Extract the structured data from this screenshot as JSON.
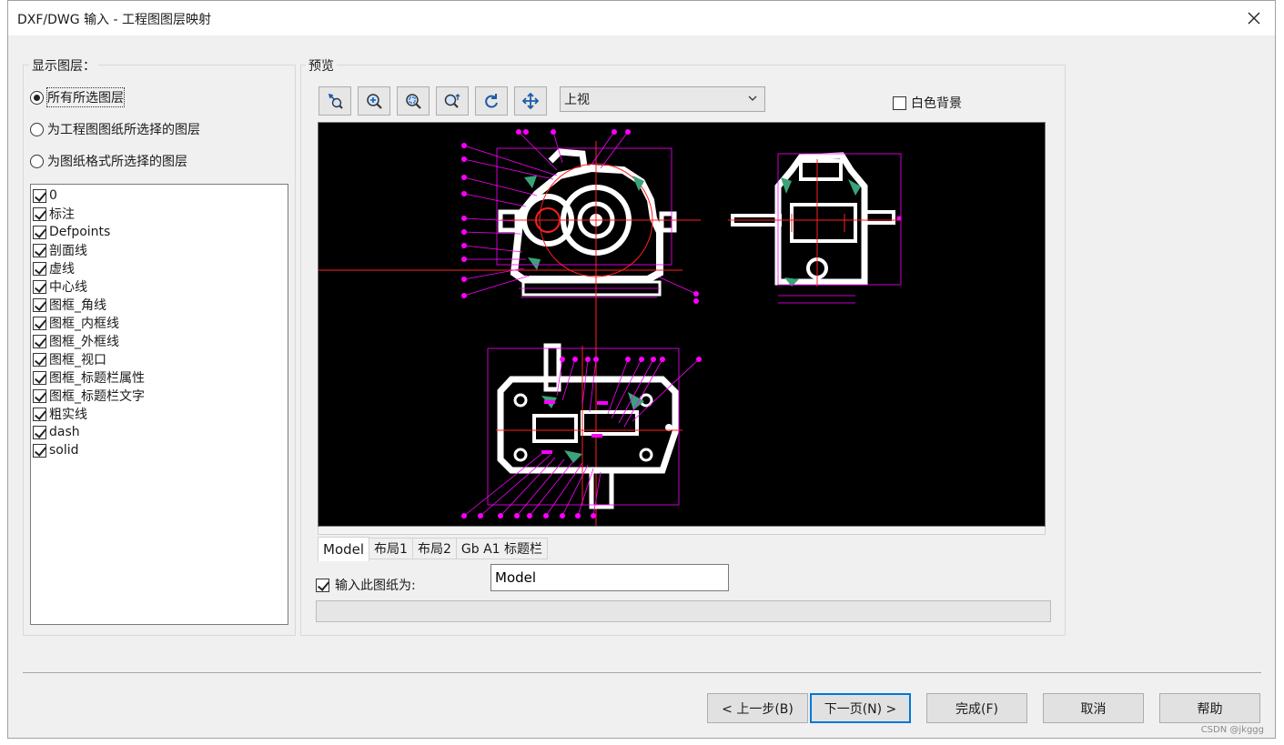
{
  "window": {
    "title": "DXF/DWG 输入 - 工程图图层映射",
    "close_icon": "close-icon"
  },
  "layers_group": {
    "label": "显示图层：",
    "radio_options": [
      {
        "label": "所有所选图层",
        "checked": true
      },
      {
        "label": "为工程图图纸所选择的图层",
        "checked": false
      },
      {
        "label": "为图纸格式所选择的图层",
        "checked": false
      }
    ],
    "layers": [
      {
        "name": "0",
        "checked": true
      },
      {
        "name": "标注",
        "checked": true
      },
      {
        "name": "Defpoints",
        "checked": true
      },
      {
        "name": "剖面线",
        "checked": true
      },
      {
        "name": "虚线",
        "checked": true
      },
      {
        "name": "中心线",
        "checked": true
      },
      {
        "name": "图框_角线",
        "checked": true
      },
      {
        "name": "图框_内框线",
        "checked": true
      },
      {
        "name": "图框_外框线",
        "checked": true
      },
      {
        "name": "图框_视口",
        "checked": true
      },
      {
        "name": "图框_标题栏属性",
        "checked": true
      },
      {
        "name": "图框_标题栏文字",
        "checked": true
      },
      {
        "name": "粗实线",
        "checked": true
      },
      {
        "name": "dash",
        "checked": true
      },
      {
        "name": "solid",
        "checked": true
      }
    ]
  },
  "preview_group": {
    "label": "预览",
    "toolbar": [
      "zoom-to-fit-icon",
      "zoom-in-icon",
      "zoom-window-icon",
      "zoom-dynamic-icon",
      "refresh-icon",
      "pan-icon"
    ],
    "view_select": {
      "value": "上视"
    },
    "white_background": {
      "label": "白色背景",
      "checked": false
    },
    "tabs": [
      {
        "label": "Model",
        "active": true
      },
      {
        "label": "布局1",
        "active": false
      },
      {
        "label": "布局2",
        "active": false
      },
      {
        "label": "Gb A1 标题栏",
        "active": false
      }
    ],
    "import_sheet": {
      "label": "输入此图纸为:",
      "checked": true,
      "value": "Model"
    }
  },
  "buttons": {
    "back": "< 上一步(B)",
    "next": "下一页(N) >",
    "finish": "完成(F)",
    "cancel": "取消",
    "help": "帮助"
  },
  "watermark": "CSDN @jkggg",
  "colors": {
    "preview_bg": "#000000",
    "magenta": "#ff00ff",
    "red": "#ff2020",
    "hatch": "#3aa37a",
    "accent": "#0078d7"
  }
}
